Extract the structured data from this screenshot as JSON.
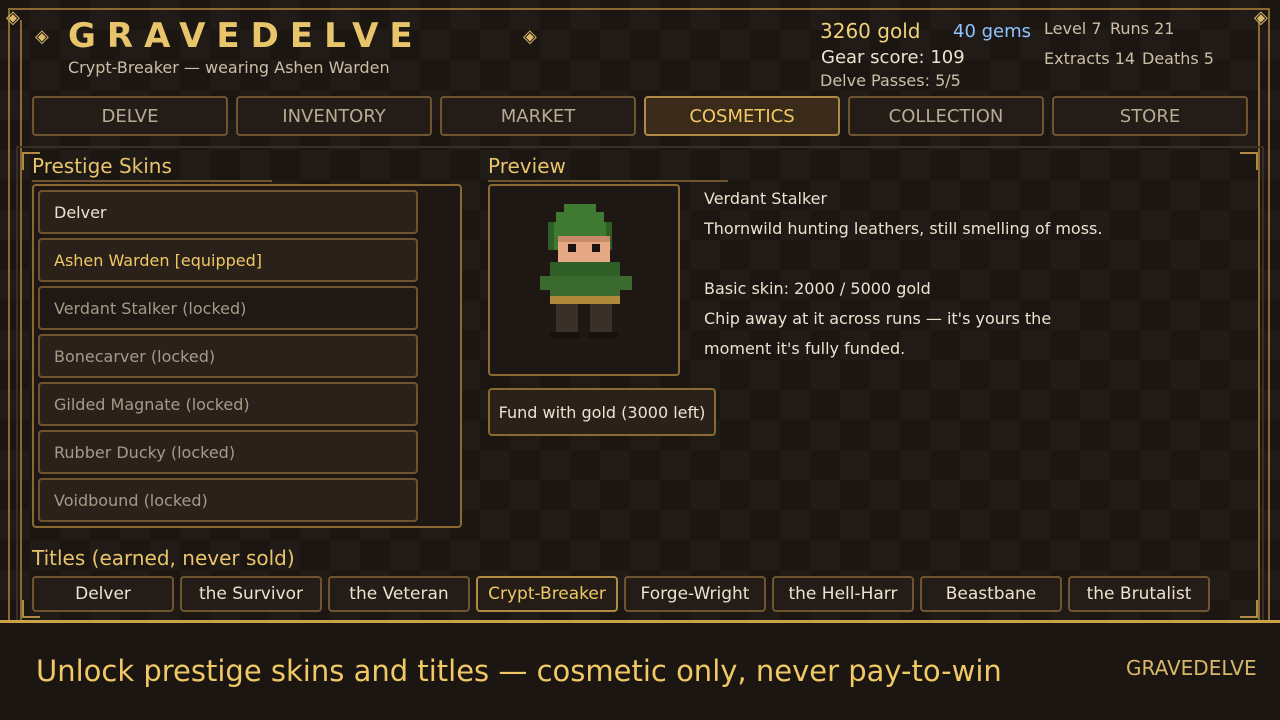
{
  "header": {
    "title": "GRAVEDELVE",
    "subtitle": "Crypt-Breaker — wearing Ashen Warden",
    "gold": "3260 gold",
    "gems": "40 gems",
    "gear_score": "Gear score: 109",
    "delve_passes": "Delve Passes: 5/5",
    "level": "Level 7",
    "runs": "Runs 21",
    "extracts": "Extracts 14",
    "deaths": "Deaths 5",
    "diamond_glyph": "◈"
  },
  "tabs": [
    {
      "label": "DELVE"
    },
    {
      "label": "INVENTORY"
    },
    {
      "label": "MARKET"
    },
    {
      "label": "COSMETICS",
      "active": true
    },
    {
      "label": "COLLECTION"
    },
    {
      "label": "STORE"
    }
  ],
  "skins": {
    "heading": "Prestige Skins",
    "items": [
      {
        "label": "Delver",
        "state": "unlocked"
      },
      {
        "label": "Ashen Warden  [equipped]",
        "state": "equipped"
      },
      {
        "label": "Verdant Stalker  (locked)",
        "state": "locked"
      },
      {
        "label": "Bonecarver  (locked)",
        "state": "locked"
      },
      {
        "label": "Gilded Magnate  (locked)",
        "state": "locked"
      },
      {
        "label": "Rubber Ducky  (locked)",
        "state": "locked"
      },
      {
        "label": "Voidbound  (locked)",
        "state": "locked"
      }
    ]
  },
  "preview": {
    "heading": "Preview",
    "name": "Verdant Stalker",
    "description": "Thornwild hunting leathers, still smelling of moss.",
    "price": "Basic skin:  2000 / 5000 gold",
    "note_line1": "Chip away at it across runs — it's yours the",
    "note_line2": "moment it's fully funded.",
    "fund_button": "Fund with gold (3000 left)",
    "funded_fraction": 0.4
  },
  "titles": {
    "heading": "Titles (earned, never sold)",
    "items": [
      {
        "label": "Delver"
      },
      {
        "label": "the Survivor"
      },
      {
        "label": "the Veteran"
      },
      {
        "label": "Crypt-Breaker",
        "active": true
      },
      {
        "label": "Forge-Wright"
      },
      {
        "label": "the Hell-Harr"
      },
      {
        "label": "Beastbane"
      },
      {
        "label": "the Brutalist"
      }
    ]
  },
  "footer": {
    "tagline": "Unlock prestige skins and titles — cosmetic only, never pay-to-win",
    "brand": "GRAVEDELVE"
  },
  "colors": {
    "accent_gold": "#f0c864",
    "gems_blue": "#8fc4ff",
    "frame": "#8a6a32"
  }
}
